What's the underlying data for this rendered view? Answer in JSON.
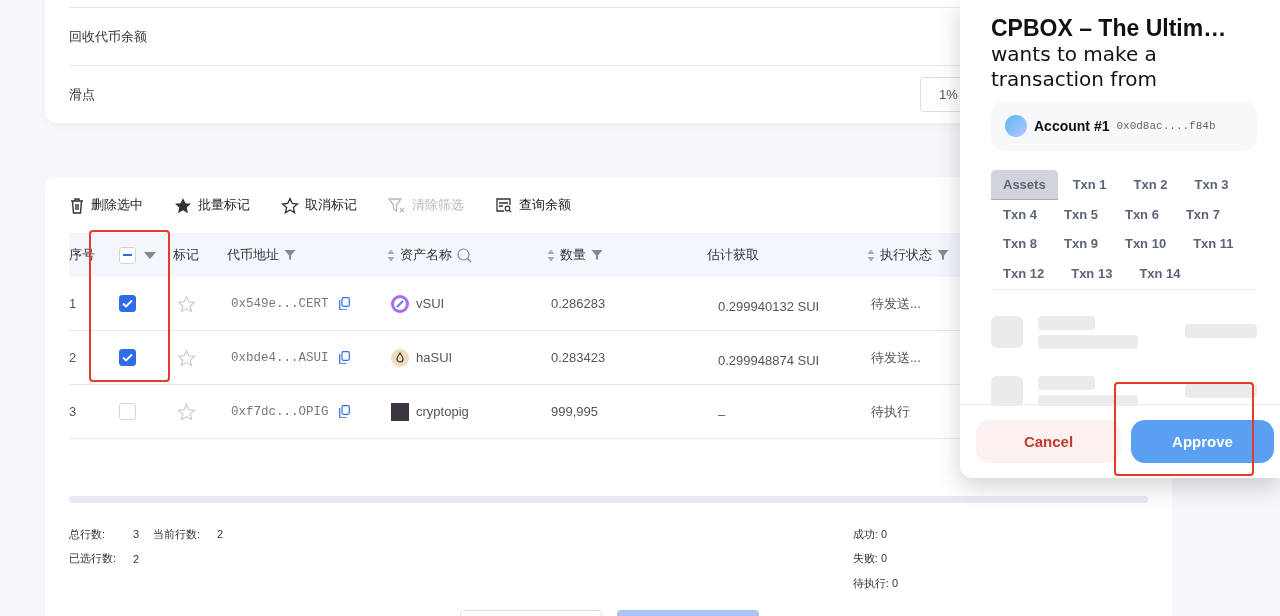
{
  "settings": {
    "rows": [
      {
        "label": "回收代币余额"
      },
      {
        "label": "滑点",
        "value": "1%"
      }
    ]
  },
  "toolbar": [
    {
      "label": "删除选中",
      "kind": "delete",
      "disabled": false
    },
    {
      "label": "批量标记",
      "kind": "mark",
      "disabled": false
    },
    {
      "label": "取消标记",
      "kind": "unmark",
      "disabled": false
    },
    {
      "label": "清除筛选",
      "kind": "clear_filter",
      "disabled": true
    },
    {
      "label": "查询余额",
      "kind": "query",
      "disabled": false
    }
  ],
  "table": {
    "select_all": {
      "indeterminate": true,
      "highlighted": true
    },
    "columns": [
      {
        "label": "序号",
        "kind": "index"
      },
      {
        "kind": "select"
      },
      {
        "label": "标记",
        "kind": "mark"
      },
      {
        "label": "代币地址",
        "kind": "address",
        "filter": true
      },
      {
        "label": "资产名称",
        "kind": "asset",
        "sortable": true,
        "search": true
      },
      {
        "label": "数量",
        "kind": "amount",
        "sortable": true,
        "filter": true
      },
      {
        "label": "估计获取",
        "kind": "estimate"
      },
      {
        "label": "执行状态",
        "kind": "status",
        "sortable": true,
        "filter": true
      }
    ],
    "rows": [
      {
        "index": "1",
        "checked": true,
        "starred": false,
        "address": "0x549e...CERT",
        "asset": "vSUI",
        "amount": "0.286283",
        "estimate": "0.299940132 SUI",
        "status": "待发送..."
      },
      {
        "index": "2",
        "checked": true,
        "starred": false,
        "address": "0xbde4...ASUI",
        "asset": "haSUI",
        "amount": "0.283423",
        "estimate": "0.299948874 SUI",
        "status": "待发送..."
      },
      {
        "index": "3",
        "checked": false,
        "starred": false,
        "address": "0xf7dc...OPIG",
        "asset": "cryptopig",
        "amount": "999,995",
        "estimate": "–",
        "status": "待执行"
      }
    ]
  },
  "summary": {
    "left": [
      [
        {
          "label": "总行数:",
          "value": "3"
        },
        {
          "label": "当前行数:",
          "value": "2"
        }
      ],
      [
        {
          "label": "已选行数:",
          "value": "2"
        }
      ]
    ],
    "right": [
      "成功: 0",
      "失败: 0",
      "待执行: 0"
    ]
  },
  "bottom_buttons": [
    {
      "kind": "outline"
    },
    {
      "kind": "primary"
    }
  ],
  "popup": {
    "title": "CPBOX – The Ultim…",
    "subtitle": "wants to make a transaction from",
    "account": {
      "name": "Account #1",
      "address": "0x0d8ac....f84b"
    },
    "tabs": [
      {
        "label": "Assets",
        "selected": true
      },
      {
        "label": "Txn 1",
        "selected": false
      },
      {
        "label": "Txn 2",
        "selected": false
      },
      {
        "label": "Txn 3",
        "selected": false
      },
      {
        "label": "Txn 4",
        "selected": false
      },
      {
        "label": "Txn 5",
        "selected": false
      },
      {
        "label": "Txn 6",
        "selected": false
      },
      {
        "label": "Txn 7",
        "selected": false
      },
      {
        "label": "Txn 8",
        "selected": false
      },
      {
        "label": "Txn 9",
        "selected": false
      },
      {
        "label": "Txn 10",
        "selected": false
      },
      {
        "label": "Txn 11",
        "selected": false
      },
      {
        "label": "Txn 12",
        "selected": false
      },
      {
        "label": "Txn 13",
        "selected": false
      },
      {
        "label": "Txn 14",
        "selected": false
      }
    ],
    "buttons": [
      {
        "label": "Cancel",
        "kind": "cancel",
        "highlighted": false
      },
      {
        "label": "Approve",
        "kind": "approve",
        "highlighted": true
      }
    ]
  }
}
